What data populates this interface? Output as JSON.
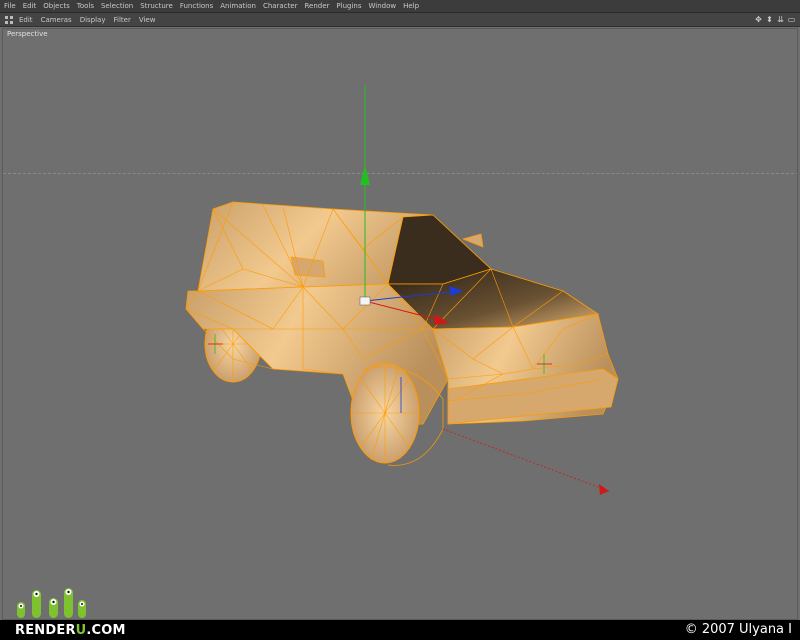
{
  "menubar": {
    "items": [
      "File",
      "Edit",
      "Objects",
      "Tools",
      "Selection",
      "Structure",
      "Functions",
      "Animation",
      "Character",
      "Render",
      "Plugins",
      "Window",
      "Help"
    ]
  },
  "toolbar": {
    "items": [
      "Edit",
      "Cameras",
      "Display",
      "Filter",
      "View"
    ],
    "nav_icons": [
      "move-view-icon",
      "dolly-view-icon",
      "zoom-view-icon",
      "maximize-view-icon"
    ]
  },
  "viewport": {
    "label": "Perspective",
    "object": "car-wireframe-model"
  },
  "watermark": {
    "brand_prefix": "RENDER",
    "brand_highlight": "U",
    "brand_suffix": ".COM",
    "copyright": "© 2007 Ulyana I"
  },
  "colors": {
    "wire": "#ff9b00",
    "body": "#e8b97a",
    "axis_y": "#20c020",
    "axis_x": "#d01818",
    "axis_z": "#1a3cd8",
    "brand_green": "#7ec230"
  }
}
